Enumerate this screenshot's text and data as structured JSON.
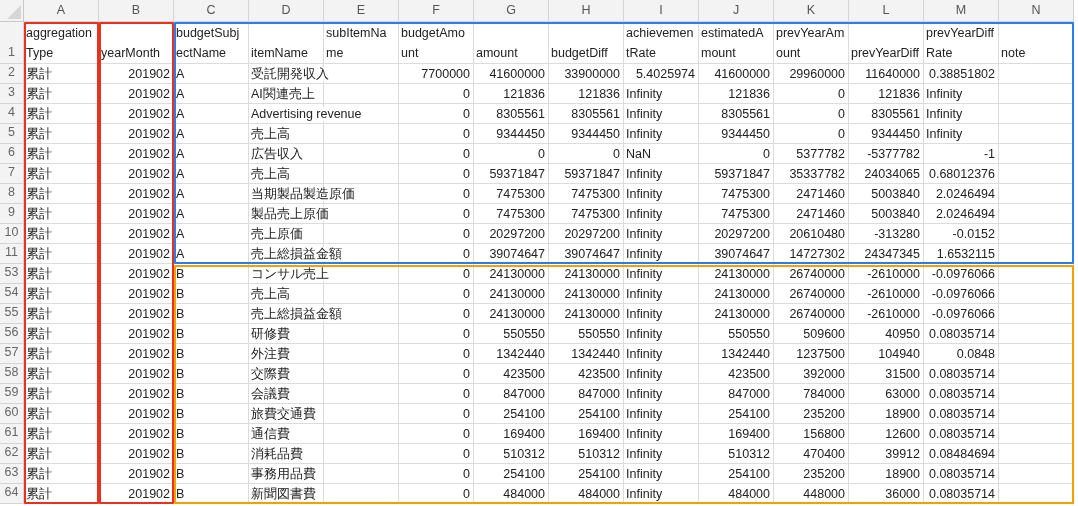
{
  "columns": [
    {
      "label": "A",
      "color": "#e8321e"
    },
    {
      "label": "B",
      "color": "#e8321e"
    },
    {
      "label": "C"
    },
    {
      "label": "D"
    },
    {
      "label": "E"
    },
    {
      "label": "F"
    },
    {
      "label": "G"
    },
    {
      "label": "H"
    },
    {
      "label": "I"
    },
    {
      "label": "J"
    },
    {
      "label": "K"
    },
    {
      "label": "L"
    },
    {
      "label": "M"
    },
    {
      "label": "N"
    }
  ],
  "row_groups": [
    {
      "color": "#2b7de9",
      "rows": [
        {
          "number": "1",
          "cells": [
            "aggregationType",
            "yearMonth",
            "budgetSubjectName",
            "itemName",
            "subItemName",
            "budgetAmount",
            "amount",
            "budgetDiff",
            "achievementRate",
            "estimatedAmount",
            "prevYearAmount",
            "prevYearDiff",
            "prevYearDiffRate",
            "note"
          ]
        },
        {
          "number": "2",
          "cells": [
            "累計",
            "201902",
            "A",
            "受託開発収入",
            null,
            "7700000",
            "41600000",
            "33900000",
            "5.4025974",
            "41600000",
            "29960000",
            "11640000",
            "0.38851802",
            null
          ]
        },
        {
          "number": "3",
          "cells": [
            "累計",
            "201902",
            "A",
            "AI関連売上",
            null,
            "0",
            "121836",
            "121836",
            "Infinity",
            "121836",
            "0",
            "121836",
            "Infinity",
            null
          ]
        },
        {
          "number": "4",
          "cells": [
            "累計",
            "201902",
            "A",
            "Advertising revenue",
            null,
            "0",
            "8305561",
            "8305561",
            "Infinity",
            "8305561",
            "0",
            "8305561",
            "Infinity",
            null
          ]
        },
        {
          "number": "5",
          "cells": [
            "累計",
            "201902",
            "A",
            "売上高",
            null,
            "0",
            "9344450",
            "9344450",
            "Infinity",
            "9344450",
            "0",
            "9344450",
            "Infinity",
            null
          ]
        },
        {
          "number": "6",
          "cells": [
            "累計",
            "201902",
            "A",
            "広告収入",
            null,
            "0",
            "0",
            "0",
            "NaN",
            "0",
            "5377782",
            "-5377782",
            "-1",
            null
          ]
        },
        {
          "number": "7",
          "cells": [
            "累計",
            "201902",
            "A",
            "売上高",
            null,
            "0",
            "59371847",
            "59371847",
            "Infinity",
            "59371847",
            "35337782",
            "24034065",
            "0.68012376",
            null
          ]
        },
        {
          "number": "8",
          "cells": [
            "累計",
            "201902",
            "A",
            "当期製品製造原価",
            null,
            "0",
            "7475300",
            "7475300",
            "Infinity",
            "7475300",
            "2471460",
            "5003840",
            "2.0246494",
            null
          ]
        },
        {
          "number": "9",
          "cells": [
            "累計",
            "201902",
            "A",
            "製品売上原価",
            null,
            "0",
            "7475300",
            "7475300",
            "Infinity",
            "7475300",
            "2471460",
            "5003840",
            "2.0246494",
            null
          ]
        },
        {
          "number": "10",
          "cells": [
            "累計",
            "201902",
            "A",
            "売上原価",
            null,
            "0",
            "20297200",
            "20297200",
            "Infinity",
            "20297200",
            "20610480",
            "-313280",
            "-0.0152",
            null
          ]
        },
        {
          "number": "11",
          "cells": [
            "累計",
            "201902",
            "A",
            "売上総損益金額",
            null,
            "0",
            "39074647",
            "39074647",
            "Infinity",
            "39074647",
            "14727302",
            "24347345",
            "1.6532115",
            null
          ]
        }
      ]
    },
    {
      "color": "#f5a000",
      "rows": [
        {
          "number": "53",
          "cells": [
            "累計",
            "201902",
            "B",
            "コンサル売上",
            null,
            "0",
            "24130000",
            "24130000",
            "Infinity",
            "24130000",
            "26740000",
            "-2610000",
            "-0.0976066",
            null
          ]
        },
        {
          "number": "54",
          "cells": [
            "累計",
            "201902",
            "B",
            "売上高",
            null,
            "0",
            "24130000",
            "24130000",
            "Infinity",
            "24130000",
            "26740000",
            "-2610000",
            "-0.0976066",
            null
          ]
        },
        {
          "number": "55",
          "cells": [
            "累計",
            "201902",
            "B",
            "売上総損益金額",
            null,
            "0",
            "24130000",
            "24130000",
            "Infinity",
            "24130000",
            "26740000",
            "-2610000",
            "-0.0976066",
            null
          ]
        },
        {
          "number": "56",
          "cells": [
            "累計",
            "201902",
            "B",
            "研修費",
            null,
            "0",
            "550550",
            "550550",
            "Infinity",
            "550550",
            "509600",
            "40950",
            "0.08035714",
            null
          ]
        },
        {
          "number": "57",
          "cells": [
            "累計",
            "201902",
            "B",
            "外注費",
            null,
            "0",
            "1342440",
            "1342440",
            "Infinity",
            "1342440",
            "1237500",
            "104940",
            "0.0848",
            null
          ]
        },
        {
          "number": "58",
          "cells": [
            "累計",
            "201902",
            "B",
            "交際費",
            null,
            "0",
            "423500",
            "423500",
            "Infinity",
            "423500",
            "392000",
            "31500",
            "0.08035714",
            null
          ]
        },
        {
          "number": "59",
          "cells": [
            "累計",
            "201902",
            "B",
            "会議費",
            null,
            "0",
            "847000",
            "847000",
            "Infinity",
            "847000",
            "784000",
            "63000",
            "0.08035714",
            null
          ]
        },
        {
          "number": "60",
          "cells": [
            "累計",
            "201902",
            "B",
            "旅費交通費",
            null,
            "0",
            "254100",
            "254100",
            "Infinity",
            "254100",
            "235200",
            "18900",
            "0.08035714",
            null
          ]
        },
        {
          "number": "61",
          "cells": [
            "累計",
            "201902",
            "B",
            "通信費",
            null,
            "0",
            "169400",
            "169400",
            "Infinity",
            "169400",
            "156800",
            "12600",
            "0.08035714",
            null
          ]
        },
        {
          "number": "62",
          "cells": [
            "累計",
            "201902",
            "B",
            "消耗品費",
            null,
            "0",
            "510312",
            "510312",
            "Infinity",
            "510312",
            "470400",
            "39912",
            "0.08484694",
            null
          ]
        },
        {
          "number": "63",
          "cells": [
            "累計",
            "201902",
            "B",
            "事務用品費",
            null,
            "0",
            "254100",
            "254100",
            "Infinity",
            "254100",
            "235200",
            "18900",
            "0.08035714",
            null
          ]
        },
        {
          "number": "64",
          "cells": [
            "累計",
            "201902",
            "B",
            "新聞図書費",
            null,
            "0",
            "484000",
            "484000",
            "Infinity",
            "484000",
            "448000",
            "36000",
            "0.08035714",
            null
          ]
        }
      ]
    }
  ]
}
